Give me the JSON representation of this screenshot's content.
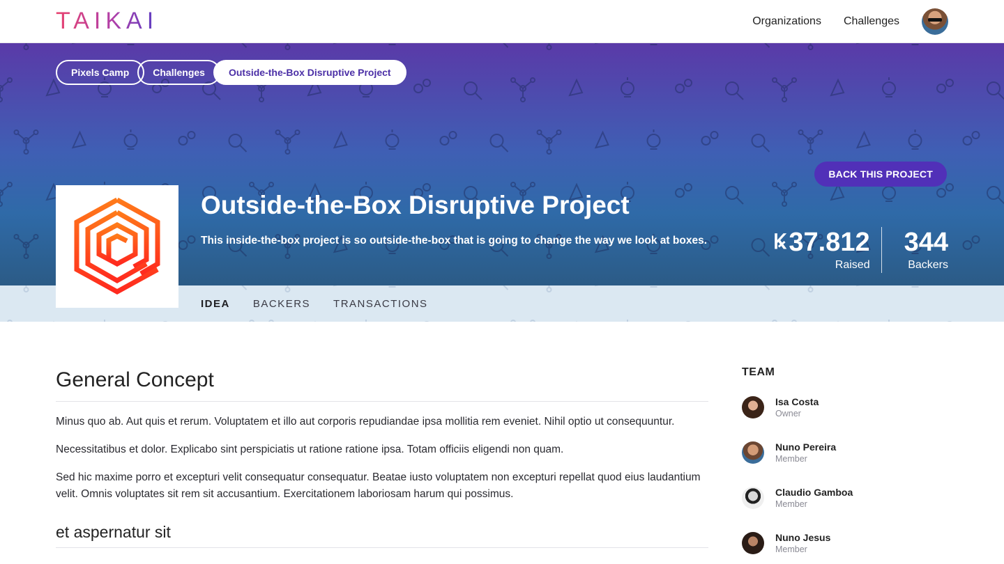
{
  "brand": {
    "logo_text": "TAIKAI"
  },
  "nav": {
    "links": [
      {
        "label": "Organizations"
      },
      {
        "label": "Challenges"
      }
    ]
  },
  "breadcrumb": {
    "items": [
      {
        "label": "Pixels Camp"
      },
      {
        "label": "Challenges"
      },
      {
        "label": "Outside-the-Box Disruptive Project"
      }
    ]
  },
  "hero": {
    "back_button": "BACK THIS PROJECT",
    "title": "Outside-the-Box Disruptive Project",
    "subtitle": "This inside-the-box project is so outside-the-box that is going to change the way we look at boxes.",
    "raised": {
      "value": "37.812",
      "label": "Raised",
      "currency_symbol": "Ꝃ"
    },
    "backers": {
      "value": "344",
      "label": "Backers"
    }
  },
  "tabs": [
    {
      "label": "IDEA",
      "active": true
    },
    {
      "label": "BACKERS",
      "active": false
    },
    {
      "label": "TRANSACTIONS",
      "active": false
    }
  ],
  "content": {
    "heading": "General Concept",
    "paragraphs": [
      "Minus quo ab. Aut quis et rerum. Voluptatem et illo aut corporis repudiandae ipsa mollitia rem eveniet. Nihil optio ut consequuntur.",
      "Necessitatibus et dolor. Explicabo sint perspiciatis ut ratione ratione ipsa. Totam officiis eligendi non quam.",
      "Sed hic maxime porro et excepturi velit consequatur consequatur. Beatae iusto voluptatem non excepturi repellat quod eius laudantium velit. Omnis voluptates sit rem sit accusantium. Exercitationem laboriosam harum qui possimus."
    ],
    "subheading": "et aspernatur sit"
  },
  "team": {
    "title": "TEAM",
    "members": [
      {
        "name": "Isa Costa",
        "role": "Owner"
      },
      {
        "name": "Nuno Pereira",
        "role": "Member"
      },
      {
        "name": "Claudio Gamboa",
        "role": "Member"
      },
      {
        "name": "Nuno Jesus",
        "role": "Member"
      }
    ]
  },
  "colors": {
    "accent": "#5130b8",
    "brand_gradient_start": "#e8436f",
    "brand_gradient_end": "#5b3fc4",
    "project_logo": "#ff5a1f"
  }
}
